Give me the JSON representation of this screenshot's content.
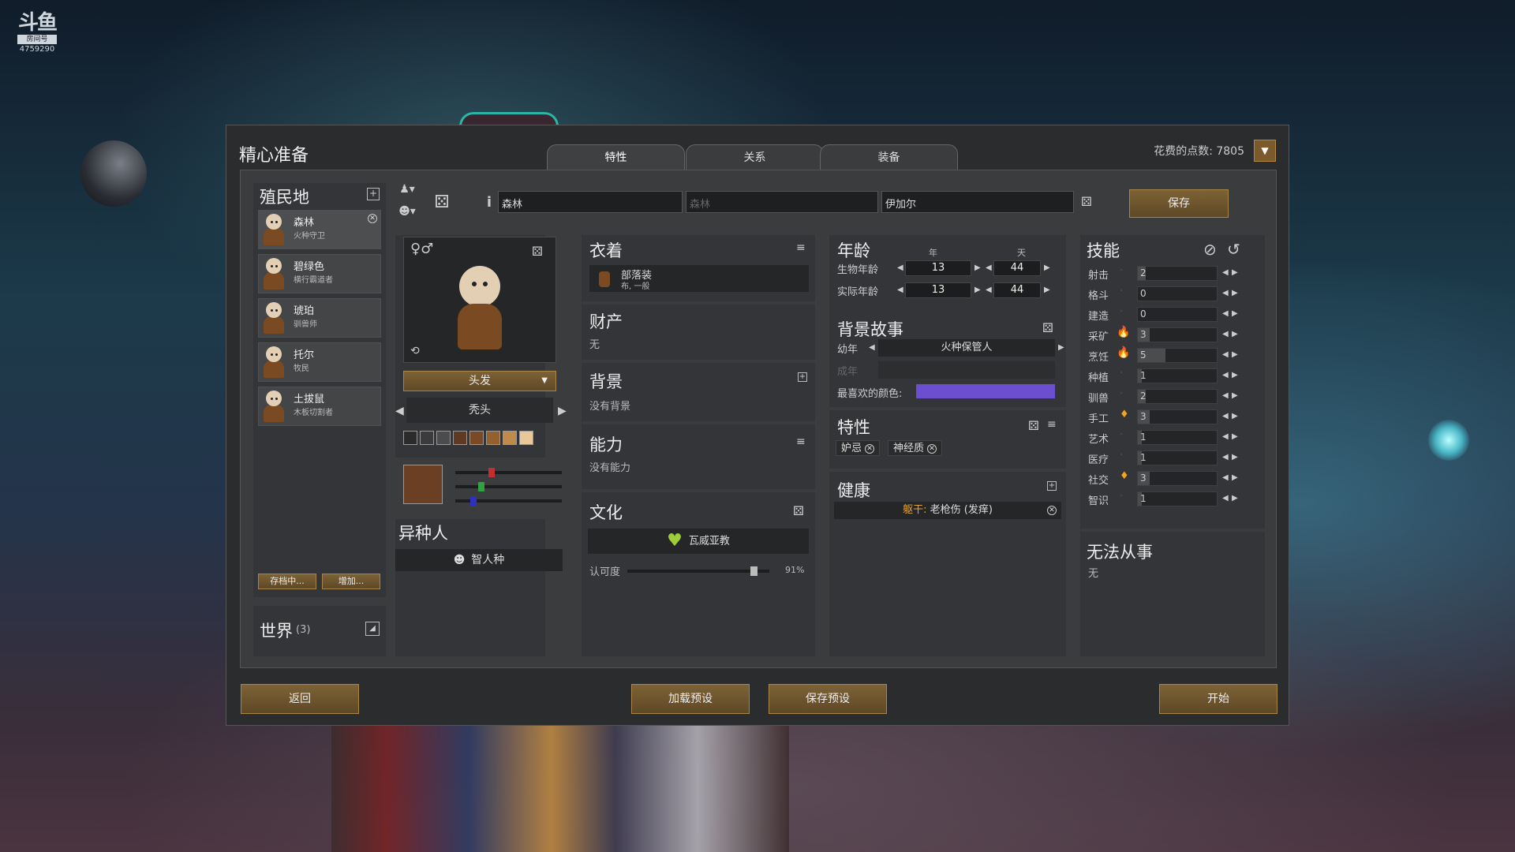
{
  "watermark": {
    "logo": "斗鱼",
    "badge": "房间号",
    "room": "4759290"
  },
  "window": {
    "title": "精心准备",
    "points_label": "花费的点数: 7805",
    "tabs": [
      "特性",
      "关系",
      "装备"
    ]
  },
  "colonists": {
    "header": "殖民地",
    "items": [
      {
        "name": "森林",
        "role": "火种守卫"
      },
      {
        "name": "碧绿色",
        "role": "横行霸道者"
      },
      {
        "name": "琥珀",
        "role": "驯兽师"
      },
      {
        "name": "托尔",
        "role": "牧民"
      },
      {
        "name": "土拔鼠",
        "role": "木板切割者"
      }
    ],
    "archive_btn": "存档中...",
    "add_btn": "增加...",
    "world_label": "世界",
    "world_count": "(3)"
  },
  "name_fields": {
    "first": "森林",
    "nick": "森林",
    "last": "伊加尔",
    "save": "保存"
  },
  "appearance": {
    "gender": "♀♂",
    "hair_select": "头发",
    "hair_style": "秃头",
    "swatches": [
      "#2b2b2b",
      "#3b3b3b",
      "#4c4c4c",
      "#5e3a22",
      "#7a4a26",
      "#94602e",
      "#c08a4a",
      "#e8c898"
    ],
    "selected_color": "#6a3f24",
    "sliders": [
      {
        "color": "#c03030",
        "value": 0.33
      },
      {
        "color": "#30a040",
        "value": 0.23
      },
      {
        "color": "#3030c0",
        "value": 0.15
      }
    ]
  },
  "xenotype": {
    "header": "异种人",
    "value": "智人种"
  },
  "apparel": {
    "header": "衣着",
    "item": "部落装",
    "sub": "布, 一般"
  },
  "possessions": {
    "header": "财产",
    "value": "无"
  },
  "background": {
    "header": "背景",
    "value": "没有背景"
  },
  "abilities": {
    "header": "能力",
    "value": "没有能力"
  },
  "culture": {
    "header": "文化",
    "value": "瓦威亚教",
    "certainty_label": "认可度",
    "certainty_pct": "91%",
    "certainty": 0.91
  },
  "age": {
    "header": "年龄",
    "col_year": "年",
    "col_day": "天",
    "bio_label": "生物年龄",
    "bio_year": "13",
    "bio_day": "44",
    "chron_label": "实际年龄",
    "chron_year": "13",
    "chron_day": "44"
  },
  "backstory": {
    "header": "背景故事",
    "child_label": "幼年",
    "child_value": "火种保管人",
    "adult_label": "成年",
    "fav_label": "最喜欢的颜色:",
    "fav_color": "#6b4fcf"
  },
  "traits": {
    "header": "特性",
    "items": [
      "妒忌",
      "神经质"
    ]
  },
  "health": {
    "header": "健康",
    "item_part": "躯干:",
    "item_desc": "老枪伤 (发痒)"
  },
  "skills": {
    "header": "技能",
    "items": [
      {
        "name": "射击",
        "value": "2",
        "flame": 0,
        "level": 0.1
      },
      {
        "name": "格斗",
        "value": "0",
        "flame": 0,
        "level": 0
      },
      {
        "name": "建造",
        "value": "0",
        "flame": 0,
        "level": 0
      },
      {
        "name": "采矿",
        "value": "3",
        "flame": 2,
        "level": 0.15
      },
      {
        "name": "烹饪",
        "value": "5",
        "flame": 2,
        "level": 0.35
      },
      {
        "name": "种植",
        "value": "1",
        "flame": 0,
        "level": 0.05
      },
      {
        "name": "驯兽",
        "value": "2",
        "flame": 0,
        "level": 0.1
      },
      {
        "name": "手工",
        "value": "3",
        "flame": 1,
        "level": 0.15
      },
      {
        "name": "艺术",
        "value": "1",
        "flame": 0,
        "level": 0.05
      },
      {
        "name": "医疗",
        "value": "1",
        "flame": 0,
        "level": 0.05
      },
      {
        "name": "社交",
        "value": "3",
        "flame": 1,
        "level": 0.15
      },
      {
        "name": "智识",
        "value": "1",
        "flame": 0,
        "level": 0.05
      }
    ]
  },
  "incapable": {
    "header": "无法从事",
    "value": "无"
  },
  "bottom": {
    "back": "返回",
    "load": "加载预设",
    "save_preset": "保存预设",
    "start": "开始"
  }
}
